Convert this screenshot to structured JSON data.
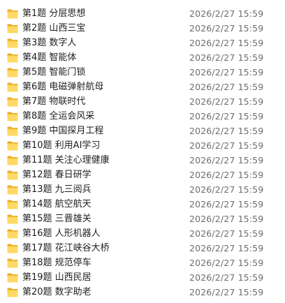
{
  "files": [
    {
      "name": "第1题 分层思想",
      "modified": "2026/2/27 15:59",
      "icon": "folder-icon"
    },
    {
      "name": "第2题 山西三宝",
      "modified": "2026/2/27 15:59",
      "icon": "folder-icon"
    },
    {
      "name": "第3题 数字人",
      "modified": "2026/2/27 15:59",
      "icon": "folder-icon"
    },
    {
      "name": "第4题 智能体",
      "modified": "2026/2/27 15:59",
      "icon": "folder-icon"
    },
    {
      "name": "第5题 智能门锁",
      "modified": "2026/2/27 15:59",
      "icon": "folder-icon"
    },
    {
      "name": "第6题 电磁弹射航母",
      "modified": "2026/2/27 15:59",
      "icon": "folder-icon"
    },
    {
      "name": "第7题 物联时代",
      "modified": "2026/2/27 15:59",
      "icon": "folder-icon"
    },
    {
      "name": "第8题 全运会风采",
      "modified": "2026/2/27 15:59",
      "icon": "folder-icon"
    },
    {
      "name": "第9题 中国探月工程",
      "modified": "2026/2/27 15:59",
      "icon": "folder-icon"
    },
    {
      "name": "第10题 利用AI学习",
      "modified": "2026/2/27 15:59",
      "icon": "folder-icon"
    },
    {
      "name": "第11题 关注心理健康",
      "modified": "2026/2/27 15:59",
      "icon": "folder-icon"
    },
    {
      "name": "第12题 春日研学",
      "modified": "2026/2/27 15:59",
      "icon": "folder-icon"
    },
    {
      "name": "第13题 九三阅兵",
      "modified": "2026/2/27 15:59",
      "icon": "folder-icon"
    },
    {
      "name": "第14题 航空航天",
      "modified": "2026/2/27 15:59",
      "icon": "folder-icon"
    },
    {
      "name": "第15题 三晋雄关",
      "modified": "2026/2/27 15:59",
      "icon": "folder-icon"
    },
    {
      "name": "第16题 人形机器人",
      "modified": "2026/2/27 15:59",
      "icon": "folder-icon"
    },
    {
      "name": "第17题 花江峡谷大桥",
      "modified": "2026/2/27 15:59",
      "icon": "folder-icon"
    },
    {
      "name": "第18题 规范停车",
      "modified": "2026/2/27 15:59",
      "icon": "folder-icon"
    },
    {
      "name": "第19题 山西民居",
      "modified": "2026/2/27 15:59",
      "icon": "folder-icon"
    },
    {
      "name": "第20题 数字助老",
      "modified": "2026/2/27 15:59",
      "icon": "folder-icon"
    }
  ],
  "colors": {
    "folder_body": "#f5c342",
    "folder_tab": "#e7ad23",
    "folder_front": "#ffd966",
    "name_text": "#1e1e1e",
    "date_text": "#6d6d6d"
  }
}
